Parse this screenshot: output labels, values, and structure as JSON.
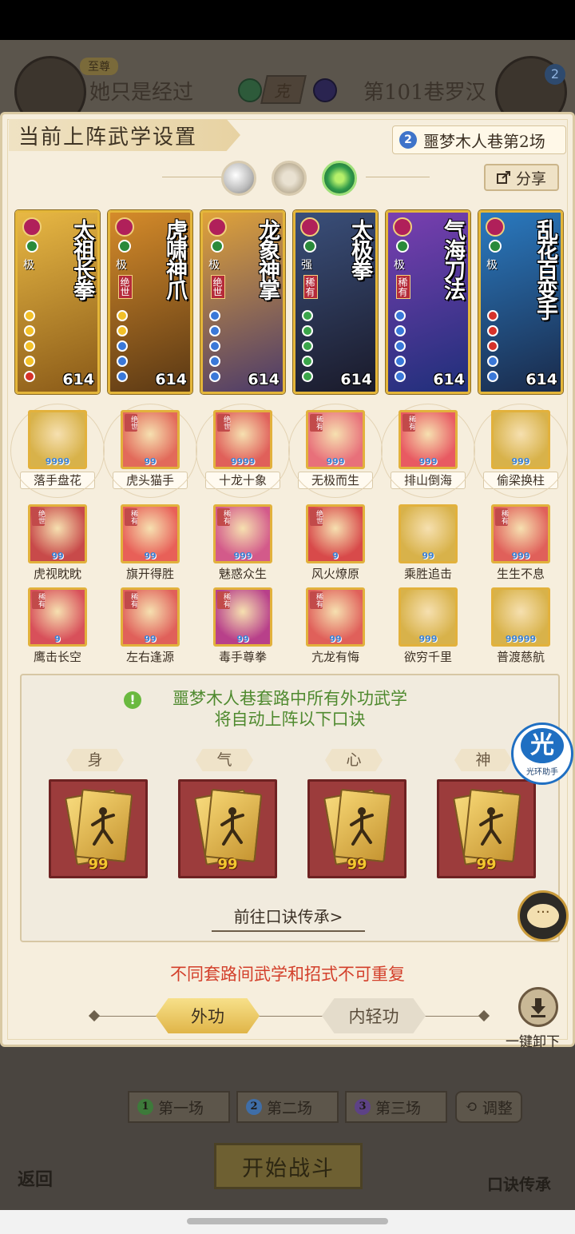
{
  "background": {
    "rank_label": "至尊",
    "player_left": "她只是经过",
    "vs_label": "克",
    "player_right": "第101巷罗汉",
    "right_level": "2",
    "rounds": [
      {
        "num": "1",
        "label": "第一场",
        "color": "#3d7a3a"
      },
      {
        "num": "2",
        "label": "第二场",
        "color": "#3f6ea8"
      },
      {
        "num": "3",
        "label": "第三场",
        "color": "#5d4286"
      }
    ],
    "adjust_label": "调整",
    "start_label": "开始战斗",
    "back_label": "返回",
    "oral_label": "口诀传承"
  },
  "dialog": {
    "title": "当前上阵武学设置",
    "stage_num": "2",
    "stage_label": "噩梦木人巷第2场",
    "share_label": "分享"
  },
  "cards": [
    {
      "name": "太祖长拳",
      "grade": "极",
      "tag": "",
      "power": "614",
      "bg": "#e8b844",
      "bg2": "#8a5a18",
      "pips": [
        "#f2c028",
        "#f2c028",
        "#f2c028",
        "#f2c028",
        "#d6322a"
      ]
    },
    {
      "name": "虎啸神爪",
      "grade": "极",
      "tag": "绝世",
      "power": "614",
      "bg": "#d58b2a",
      "bg2": "#5a3814",
      "pips": [
        "#f2c028",
        "#f2c028",
        "#3a78d8",
        "#3a78d8",
        "#3a78d8"
      ]
    },
    {
      "name": "龙象神掌",
      "grade": "极",
      "tag": "绝世",
      "power": "614",
      "bg": "#e0a33a",
      "bg2": "#4b3a6a",
      "pips": [
        "#3a78d8",
        "#3a78d8",
        "#3a78d8",
        "#3a78d8",
        "#3a78d8"
      ]
    },
    {
      "name": "太极拳",
      "grade": "强",
      "tag": "稀有",
      "power": "614",
      "bg": "#3a4f7a",
      "bg2": "#1a1a2a",
      "pips": [
        "#3aa54a",
        "#3aa54a",
        "#3aa54a",
        "#3aa54a",
        "#3aa54a"
      ]
    },
    {
      "name": "气海刀法",
      "grade": "极",
      "tag": "稀有",
      "power": "614",
      "bg": "#7a3fb0",
      "bg2": "#1f2f7a",
      "pips": [
        "#3a78d8",
        "#3a78d8",
        "#3a78d8",
        "#3a78d8",
        "#3a78d8"
      ]
    },
    {
      "name": "乱花百变手",
      "grade": "极",
      "tag": "",
      "power": "614",
      "bg": "#2a7ac0",
      "bg2": "#1a2a4a",
      "pips": [
        "#d6322a",
        "#d6322a",
        "#d6322a",
        "#3a78d8",
        "#3a78d8"
      ]
    }
  ],
  "skills_row1": [
    {
      "label": "落手盘花",
      "badge": "",
      "count": "9999",
      "bg": "#d8b24a"
    },
    {
      "label": "虎头猫手",
      "badge": "绝世",
      "count": "99",
      "bg": "#e26a5a"
    },
    {
      "label": "十龙十象",
      "badge": "绝世",
      "count": "9999",
      "bg": "#e0605a"
    },
    {
      "label": "无极而生",
      "badge": "稀有",
      "count": "999",
      "bg": "#e8707a"
    },
    {
      "label": "排山倒海",
      "badge": "稀有",
      "count": "999",
      "bg": "#e85a62"
    },
    {
      "label": "偷梁换柱",
      "badge": "",
      "count": "999",
      "bg": "#d8b24a"
    }
  ],
  "skills_row2": [
    {
      "label": "虎视眈眈",
      "badge": "绝世",
      "count": "99",
      "bg": "#c84a4a"
    },
    {
      "label": "旗开得胜",
      "badge": "稀有",
      "count": "99",
      "bg": "#e86058"
    },
    {
      "label": "魅惑众生",
      "badge": "稀有",
      "count": "999",
      "bg": "#d35a8a"
    },
    {
      "label": "风火燎原",
      "badge": "绝世",
      "count": "9",
      "bg": "#d84a4a"
    },
    {
      "label": "乘胜追击",
      "badge": "",
      "count": "99",
      "bg": "#d8b24a"
    },
    {
      "label": "生生不息",
      "badge": "稀有",
      "count": "999",
      "bg": "#e0605a"
    }
  ],
  "skills_row3": [
    {
      "label": "鹰击长空",
      "badge": "稀有",
      "count": "9",
      "bg": "#d8505a"
    },
    {
      "label": "左右逢源",
      "badge": "稀有",
      "count": "99",
      "bg": "#e0605a"
    },
    {
      "label": "毒手尊拳",
      "badge": "稀有",
      "count": "99",
      "bg": "#b8408a"
    },
    {
      "label": "亢龙有悔",
      "badge": "稀有",
      "count": "99",
      "bg": "#e0605a"
    },
    {
      "label": "欲穷千里",
      "badge": "",
      "count": "999",
      "bg": "#d8b24a"
    },
    {
      "label": "普渡慈航",
      "badge": "",
      "count": "99999",
      "bg": "#d8b24a"
    }
  ],
  "formula": {
    "line1": "噩梦木人巷套路中所有外功武学",
    "line2": "将自动上阵以下口诀",
    "slots": [
      {
        "tag": "身",
        "count": "99"
      },
      {
        "tag": "气",
        "count": "99"
      },
      {
        "tag": "心",
        "count": "99"
      },
      {
        "tag": "神",
        "count": "99"
      }
    ],
    "goto_label": "前往口诀传承>"
  },
  "warning": "不同套路间武学和招式不可重复",
  "modes": {
    "outer": "外功",
    "inner": "内轻功"
  },
  "unload_label": "一键卸下",
  "helper": {
    "big": "光",
    "small": "光环助手"
  },
  "chat_label": "···"
}
